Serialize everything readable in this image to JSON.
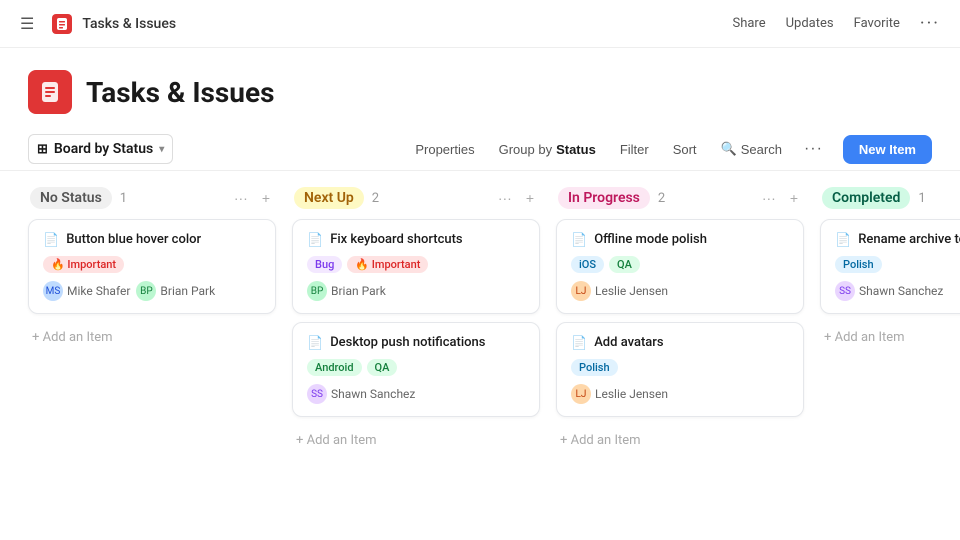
{
  "nav": {
    "hamburger": "☰",
    "logo_icon": "📌",
    "title": "Tasks & Issues",
    "share": "Share",
    "updates": "Updates",
    "favorite": "Favorite",
    "more": "···"
  },
  "page": {
    "icon": "📌",
    "title": "Tasks & Issues"
  },
  "toolbar": {
    "board_label": "Board by Status",
    "properties": "Properties",
    "group_by_prefix": "Group by ",
    "group_by_value": "Status",
    "filter": "Filter",
    "sort": "Sort",
    "search": "Search",
    "more": "···",
    "new_item": "New Item"
  },
  "columns": [
    {
      "id": "no-status",
      "title": "No Status",
      "count": 1,
      "cards": [
        {
          "title": "Button blue hover color",
          "tags": [
            {
              "label": "🔥 Important",
              "type": "important"
            }
          ],
          "assignees": [
            {
              "name": "Mike Shafer",
              "initials": "MS",
              "color": "av-blue"
            },
            {
              "name": "Brian Park",
              "initials": "BP",
              "color": "av-green"
            }
          ]
        }
      ]
    },
    {
      "id": "next-up",
      "title": "Next Up",
      "count": 2,
      "cards": [
        {
          "title": "Fix keyboard shortcuts",
          "tags": [
            {
              "label": "Bug",
              "type": "bug"
            },
            {
              "label": "🔥 Important",
              "type": "important"
            }
          ],
          "assignees": [
            {
              "name": "Brian Park",
              "initials": "BP",
              "color": "av-green"
            }
          ]
        },
        {
          "title": "Desktop push notifications",
          "tags": [
            {
              "label": "Android",
              "type": "android"
            },
            {
              "label": "QA",
              "type": "qa"
            }
          ],
          "assignees": [
            {
              "name": "Shawn Sanchez",
              "initials": "SS",
              "color": "av-purple"
            }
          ]
        }
      ]
    },
    {
      "id": "in-progress",
      "title": "In Progress",
      "count": 2,
      "cards": [
        {
          "title": "Offline mode polish",
          "tags": [
            {
              "label": "iOS",
              "type": "ios"
            },
            {
              "label": "QA",
              "type": "qa"
            }
          ],
          "assignees": [
            {
              "name": "Leslie Jensen",
              "initials": "LJ",
              "color": "av-orange"
            }
          ]
        },
        {
          "title": "Add avatars",
          "tags": [
            {
              "label": "Polish",
              "type": "polish"
            }
          ],
          "assignees": [
            {
              "name": "Leslie Jensen",
              "initials": "LJ",
              "color": "av-orange"
            }
          ]
        }
      ]
    },
    {
      "id": "completed",
      "title": "Completed",
      "count": 1,
      "cards": [
        {
          "title": "Rename archive to trash",
          "tags": [
            {
              "label": "Polish",
              "type": "polish"
            }
          ],
          "assignees": [
            {
              "name": "Shawn Sanchez",
              "initials": "SS",
              "color": "av-purple"
            }
          ]
        }
      ]
    }
  ],
  "add_item_label": "+ Add an Item"
}
